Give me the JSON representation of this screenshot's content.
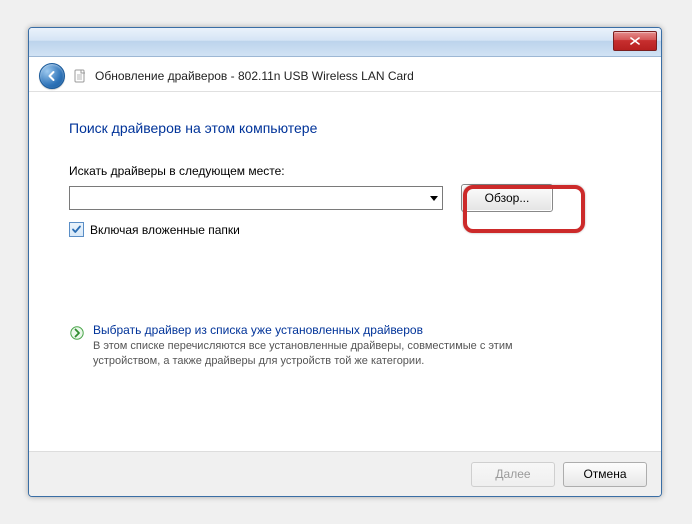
{
  "window": {
    "title": "Обновление драйверов - 802.11n USB Wireless LAN Card"
  },
  "page": {
    "heading": "Поиск драйверов на этом компьютере",
    "search_label": "Искать драйверы в следующем месте:",
    "path_value": "",
    "browse_label": "Обзор...",
    "include_subfolders_label": "Включая вложенные папки",
    "include_subfolders_checked": true
  },
  "link": {
    "title": "Выбрать драйвер из списка уже установленных драйверов",
    "description": "В этом списке перечисляются все установленные драйверы, совместимые с этим устройством, а также драйверы для устройств той же категории."
  },
  "footer": {
    "next_label": "Далее",
    "cancel_label": "Отмена"
  },
  "icons": {
    "back": "back-arrow",
    "document": "document-icon",
    "close": "close-x",
    "dropdown": "chevron-down",
    "checkbox_check": "check-mark",
    "link_arrow": "arrow-right-green"
  },
  "colors": {
    "heading": "#003399",
    "highlight_ring": "#cc2a2a",
    "close_bg": "#c72f2f"
  }
}
